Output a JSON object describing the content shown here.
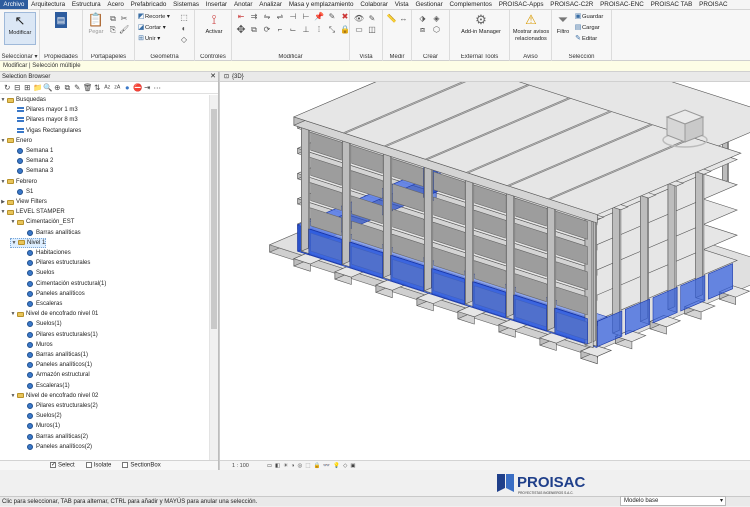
{
  "menu": {
    "tabs": [
      "Archivo",
      "Arquitectura",
      "Estructura",
      "Acero",
      "Prefabricado",
      "Sistemas",
      "Insertar",
      "Anotar",
      "Analizar",
      "Masa y emplazamiento",
      "Colaborar",
      "Vista",
      "Gestionar",
      "Complementos",
      "PROISAC-Apps",
      "PROISAC-C2R",
      "PROISAC-ENC",
      "PROISAC TAB",
      "PROISAC"
    ],
    "active": "Archivo"
  },
  "ribbon": {
    "modify_label": "Modificar",
    "select_label": "Seleccionar ▾",
    "properties_label": "Propiedades",
    "clipboard_label": "Portapapeles",
    "paste_label": "Pegar",
    "recortar": "Recorte",
    "cortar": "Cortar",
    "unir": "Unir",
    "geometry_label": "Geometría",
    "activate_label": "Activar",
    "controls_label": "Controles",
    "modify_panel_label": "Modificar",
    "view_label": "Vista",
    "measure_label": "Medir",
    "create_label": "Crear",
    "addin_manager": "Add-in Manager",
    "external_tools_label": "External Tools",
    "warnings_btn": "Mostrar avisos relacionados",
    "warnings_label": "Aviso",
    "filter_label": "Filtro",
    "save_label": "Guardar",
    "load_label": "Cargar",
    "edit_label": "Editar",
    "selection_label": "Selección"
  },
  "context": "Modificar | Selección múltiple",
  "browser": {
    "title": "Selection Browser",
    "footer": {
      "select": "Select",
      "isolate": "Isolate",
      "sectionbox": "SectionBox"
    },
    "rows": [
      {
        "label": "Busquedas",
        "level": 0,
        "icon": "folder",
        "toggle": "▼"
      },
      {
        "label": "Pilares mayor 1 m3",
        "level": 1,
        "icon": "bars"
      },
      {
        "label": "Pilares mayor 8 m3",
        "level": 1,
        "icon": "bars"
      },
      {
        "label": "Vigas Rectangulares",
        "level": 1,
        "icon": "bars"
      },
      {
        "label": "Enero",
        "level": 0,
        "icon": "folder",
        "toggle": "▼"
      },
      {
        "label": "Semana 1",
        "level": 1,
        "icon": "dot"
      },
      {
        "label": "Semana 2",
        "level": 1,
        "icon": "dot"
      },
      {
        "label": "Semana 3",
        "level": 1,
        "icon": "dot"
      },
      {
        "label": "Febrero",
        "level": 0,
        "icon": "folder",
        "toggle": "▼"
      },
      {
        "label": "S1",
        "level": 1,
        "icon": "dot"
      },
      {
        "label": "View Filters",
        "level": 0,
        "icon": "folder",
        "toggle": "▶"
      },
      {
        "label": "LEVEL STAMPER",
        "level": 0,
        "icon": "folder",
        "toggle": "▼"
      },
      {
        "label": "Cimentación_EST",
        "level": 1,
        "icon": "folder",
        "toggle": "▼"
      },
      {
        "label": "Barras analíticas",
        "level": 2,
        "icon": "dot"
      },
      {
        "label": "Nivel 1",
        "level": 1,
        "icon": "folder",
        "toggle": "▼",
        "highlight": true
      },
      {
        "label": "Habitaciones",
        "level": 2,
        "icon": "dot"
      },
      {
        "label": "Pilares estructurales",
        "level": 2,
        "icon": "dot"
      },
      {
        "label": "Suelos",
        "level": 2,
        "icon": "dot"
      },
      {
        "label": "Cimentación estructural(1)",
        "level": 2,
        "icon": "dot"
      },
      {
        "label": "Paneles analíticos",
        "level": 2,
        "icon": "dot"
      },
      {
        "label": "Escaleras",
        "level": 2,
        "icon": "dot"
      },
      {
        "label": "Nivel de encofrado nivel 01",
        "level": 1,
        "icon": "folder",
        "toggle": "▼"
      },
      {
        "label": "Suelos(1)",
        "level": 2,
        "icon": "dot"
      },
      {
        "label": "Pilares estructurales(1)",
        "level": 2,
        "icon": "dot"
      },
      {
        "label": "Muros",
        "level": 2,
        "icon": "dot"
      },
      {
        "label": "Barras analíticas(1)",
        "level": 2,
        "icon": "dot"
      },
      {
        "label": "Paneles analíticos(1)",
        "level": 2,
        "icon": "dot"
      },
      {
        "label": "Armazón estructural",
        "level": 2,
        "icon": "dot"
      },
      {
        "label": "Escaleras(1)",
        "level": 2,
        "icon": "dot"
      },
      {
        "label": "Nivel de encofrado nivel 02",
        "level": 1,
        "icon": "folder",
        "toggle": "▼"
      },
      {
        "label": "Pilares estructurales(2)",
        "level": 2,
        "icon": "dot"
      },
      {
        "label": "Suelos(2)",
        "level": 2,
        "icon": "dot"
      },
      {
        "label": "Muros(1)",
        "level": 2,
        "icon": "dot"
      },
      {
        "label": "Barras analíticas(2)",
        "level": 2,
        "icon": "dot"
      },
      {
        "label": "Paneles analíticos(2)",
        "level": 2,
        "icon": "dot"
      }
    ]
  },
  "view": {
    "tab": "{3D}",
    "scale": "1 : 100"
  },
  "status": "Clic para seleccionar, TAB para alternar, CTRL para añadir y MAYÚS para anular una selección.",
  "logo": {
    "name": "PROISAC",
    "tagline": "PROYECTISTAS INGENIEROS S.A.C."
  },
  "model_select": "Modelo base",
  "colors": {
    "selection": "#2f5de0",
    "accent": "#2d5c9e"
  }
}
